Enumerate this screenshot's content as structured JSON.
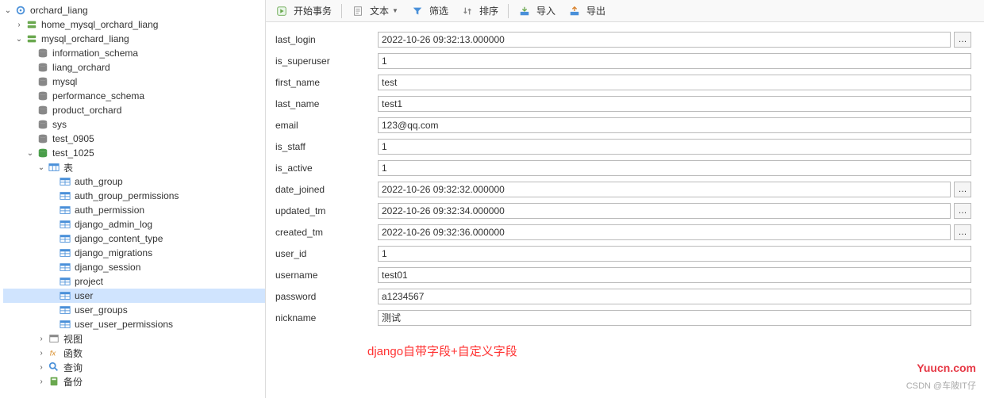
{
  "tree": {
    "root": "orchard_liang",
    "conn1": "home_mysql_orchard_liang",
    "conn2": "mysql_orchard_liang",
    "dbs": [
      "information_schema",
      "liang_orchard",
      "mysql",
      "performance_schema",
      "product_orchard",
      "sys",
      "test_0905"
    ],
    "db_open": "test_1025",
    "tables_label": "表",
    "tables": [
      "auth_group",
      "auth_group_permissions",
      "auth_permission",
      "django_admin_log",
      "django_content_type",
      "django_migrations",
      "django_session",
      "project",
      "user",
      "user_groups",
      "user_user_permissions"
    ],
    "selected_table": "user",
    "misc": {
      "views": "视图",
      "func": "函数",
      "query": "查询",
      "backup": "备份"
    }
  },
  "toolbar": {
    "begin_tx": "开始事务",
    "text": "文本",
    "filter": "筛选",
    "sort": "排序",
    "import": "导入",
    "export": "导出"
  },
  "fields": [
    {
      "name": "last_login",
      "value": "2022-10-26 09:32:13.000000",
      "picker": true
    },
    {
      "name": "is_superuser",
      "value": "1"
    },
    {
      "name": "first_name",
      "value": "test"
    },
    {
      "name": "last_name",
      "value": "test1"
    },
    {
      "name": "email",
      "value": "123@qq.com"
    },
    {
      "name": "is_staff",
      "value": "1"
    },
    {
      "name": "is_active",
      "value": "1"
    },
    {
      "name": "date_joined",
      "value": "2022-10-26 09:32:32.000000",
      "picker": true
    },
    {
      "name": "updated_tm",
      "value": "2022-10-26 09:32:34.000000",
      "picker": true
    },
    {
      "name": "created_tm",
      "value": "2022-10-26 09:32:36.000000",
      "picker": true
    },
    {
      "name": "user_id",
      "value": "1"
    },
    {
      "name": "username",
      "value": "test01"
    },
    {
      "name": "password",
      "value": "a1234567"
    },
    {
      "name": "nickname",
      "value": "测试"
    }
  ],
  "note": "django自带字段+自定义字段",
  "watermark": "Yuucn.com",
  "csdn": "CSDN @车陂IT仔"
}
